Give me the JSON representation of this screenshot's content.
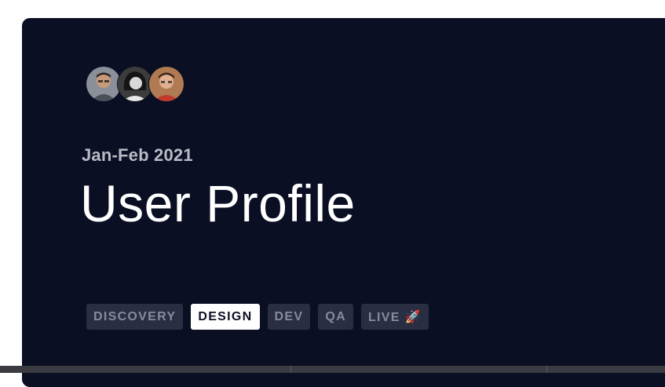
{
  "card": {
    "subtitle": "Jan-Feb 2021",
    "title": "User Profile",
    "background": "#0b0f24"
  },
  "avatars": [
    {
      "icon": "person-avatar-1"
    },
    {
      "icon": "person-avatar-2"
    },
    {
      "icon": "person-avatar-3"
    }
  ],
  "stages": [
    {
      "label": "DISCOVERY",
      "active": false
    },
    {
      "label": "DESIGN",
      "active": true
    },
    {
      "label": "DEV",
      "active": false
    },
    {
      "label": "QA",
      "active": false
    },
    {
      "label": "LIVE 🚀",
      "active": false
    }
  ]
}
